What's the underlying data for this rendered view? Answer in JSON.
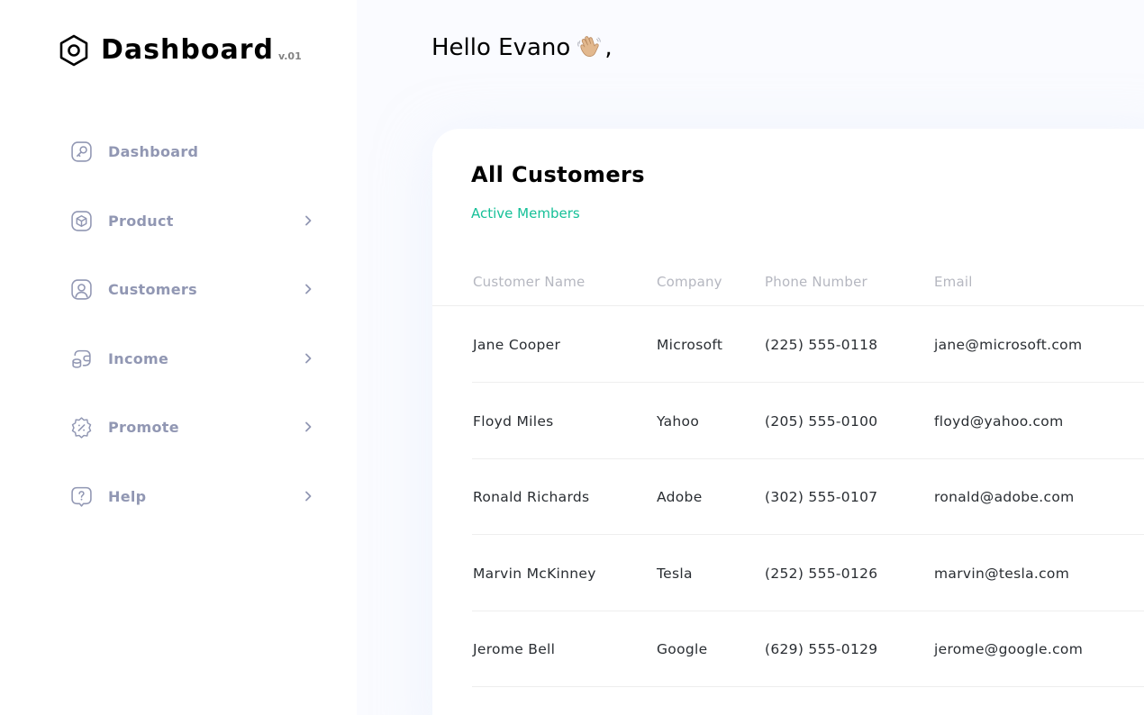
{
  "brand": {
    "title": "Dashboard",
    "version": "v.01"
  },
  "sidebar": {
    "items": [
      {
        "label": "Dashboard",
        "icon": "key-square-icon",
        "has_chevron": false
      },
      {
        "label": "Product",
        "icon": "3d-square-icon",
        "has_chevron": true
      },
      {
        "label": "Customers",
        "icon": "user-square-icon",
        "has_chevron": true
      },
      {
        "label": "Income",
        "icon": "wallet-money-icon",
        "has_chevron": true
      },
      {
        "label": "Promote",
        "icon": "discount-shape-icon",
        "has_chevron": true
      },
      {
        "label": "Help",
        "icon": "message-question-icon",
        "has_chevron": true
      }
    ]
  },
  "header": {
    "greeting": "Hello Evano",
    "greeting_suffix": ",",
    "emoji": "waving-hand-icon"
  },
  "customers": {
    "title": "All Customers",
    "subtitle": "Active Members",
    "columns": [
      "Customer Name",
      "Company",
      "Phone Number",
      "Email"
    ],
    "rows": [
      {
        "name": "Jane Cooper",
        "company": "Microsoft",
        "phone": "(225) 555-0118",
        "email": "jane@microsoft.com"
      },
      {
        "name": "Floyd Miles",
        "company": "Yahoo",
        "phone": "(205) 555-0100",
        "email": "floyd@yahoo.com"
      },
      {
        "name": "Ronald Richards",
        "company": "Adobe",
        "phone": "(302) 555-0107",
        "email": "ronald@adobe.com"
      },
      {
        "name": "Marvin McKinney",
        "company": "Tesla",
        "phone": "(252) 555-0126",
        "email": "marvin@tesla.com"
      },
      {
        "name": "Jerome Bell",
        "company": "Google",
        "phone": "(629) 555-0129",
        "email": "jerome@google.com"
      }
    ]
  },
  "colors": {
    "accent_green": "#16C098",
    "nav_text": "#9197B3",
    "header_text": "#B5B7C0",
    "body_text": "#292D32",
    "background": "#FAFBFF"
  }
}
